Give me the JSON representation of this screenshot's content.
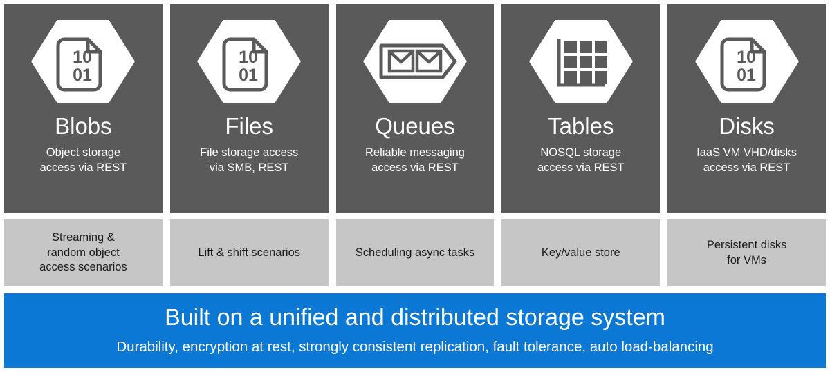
{
  "theme": {
    "panel_gray": "#5a5a5a",
    "caption_gray": "#c6c6c6",
    "banner_blue": "#0a78d4",
    "icon_white": "#ffffff",
    "icon_outline": "#5a5a5a",
    "page_background": "#ffffff"
  },
  "services": [
    {
      "id": "blobs",
      "icon": "binary-document-hexagon-icon",
      "icon_digits_top": "10",
      "icon_digits_bottom": "01",
      "title": "Blobs",
      "subtitle": "Object storage\naccess via REST",
      "scenario": "Streaming &\nrandom object\naccess scenarios"
    },
    {
      "id": "files",
      "icon": "binary-document-hexagon-icon",
      "icon_digits_top": "10",
      "icon_digits_bottom": "01",
      "title": "Files",
      "subtitle": "File storage access\nvia SMB, REST",
      "scenario": "Lift & shift scenarios"
    },
    {
      "id": "queues",
      "icon": "two-envelopes-hexagon-icon",
      "icon_digits_top": "",
      "icon_digits_bottom": "",
      "title": "Queues",
      "subtitle": "Reliable messaging\naccess via REST",
      "scenario": "Scheduling async tasks"
    },
    {
      "id": "tables",
      "icon": "grid-table-hexagon-icon",
      "icon_digits_top": "",
      "icon_digits_bottom": "",
      "title": "Tables",
      "subtitle": "NOSQL storage\naccess via REST",
      "scenario": "Key/value store"
    },
    {
      "id": "disks",
      "icon": "binary-document-hexagon-icon",
      "icon_digits_top": "10",
      "icon_digits_bottom": "01",
      "title": "Disks",
      "subtitle": "IaaS VM VHD/disks\naccess via REST",
      "scenario": "Persistent disks\nfor VMs"
    }
  ],
  "banner": {
    "title": "Built on a unified and distributed storage system",
    "subtitle": "Durability, encryption at rest, strongly consistent replication, fault tolerance, auto load-balancing"
  }
}
